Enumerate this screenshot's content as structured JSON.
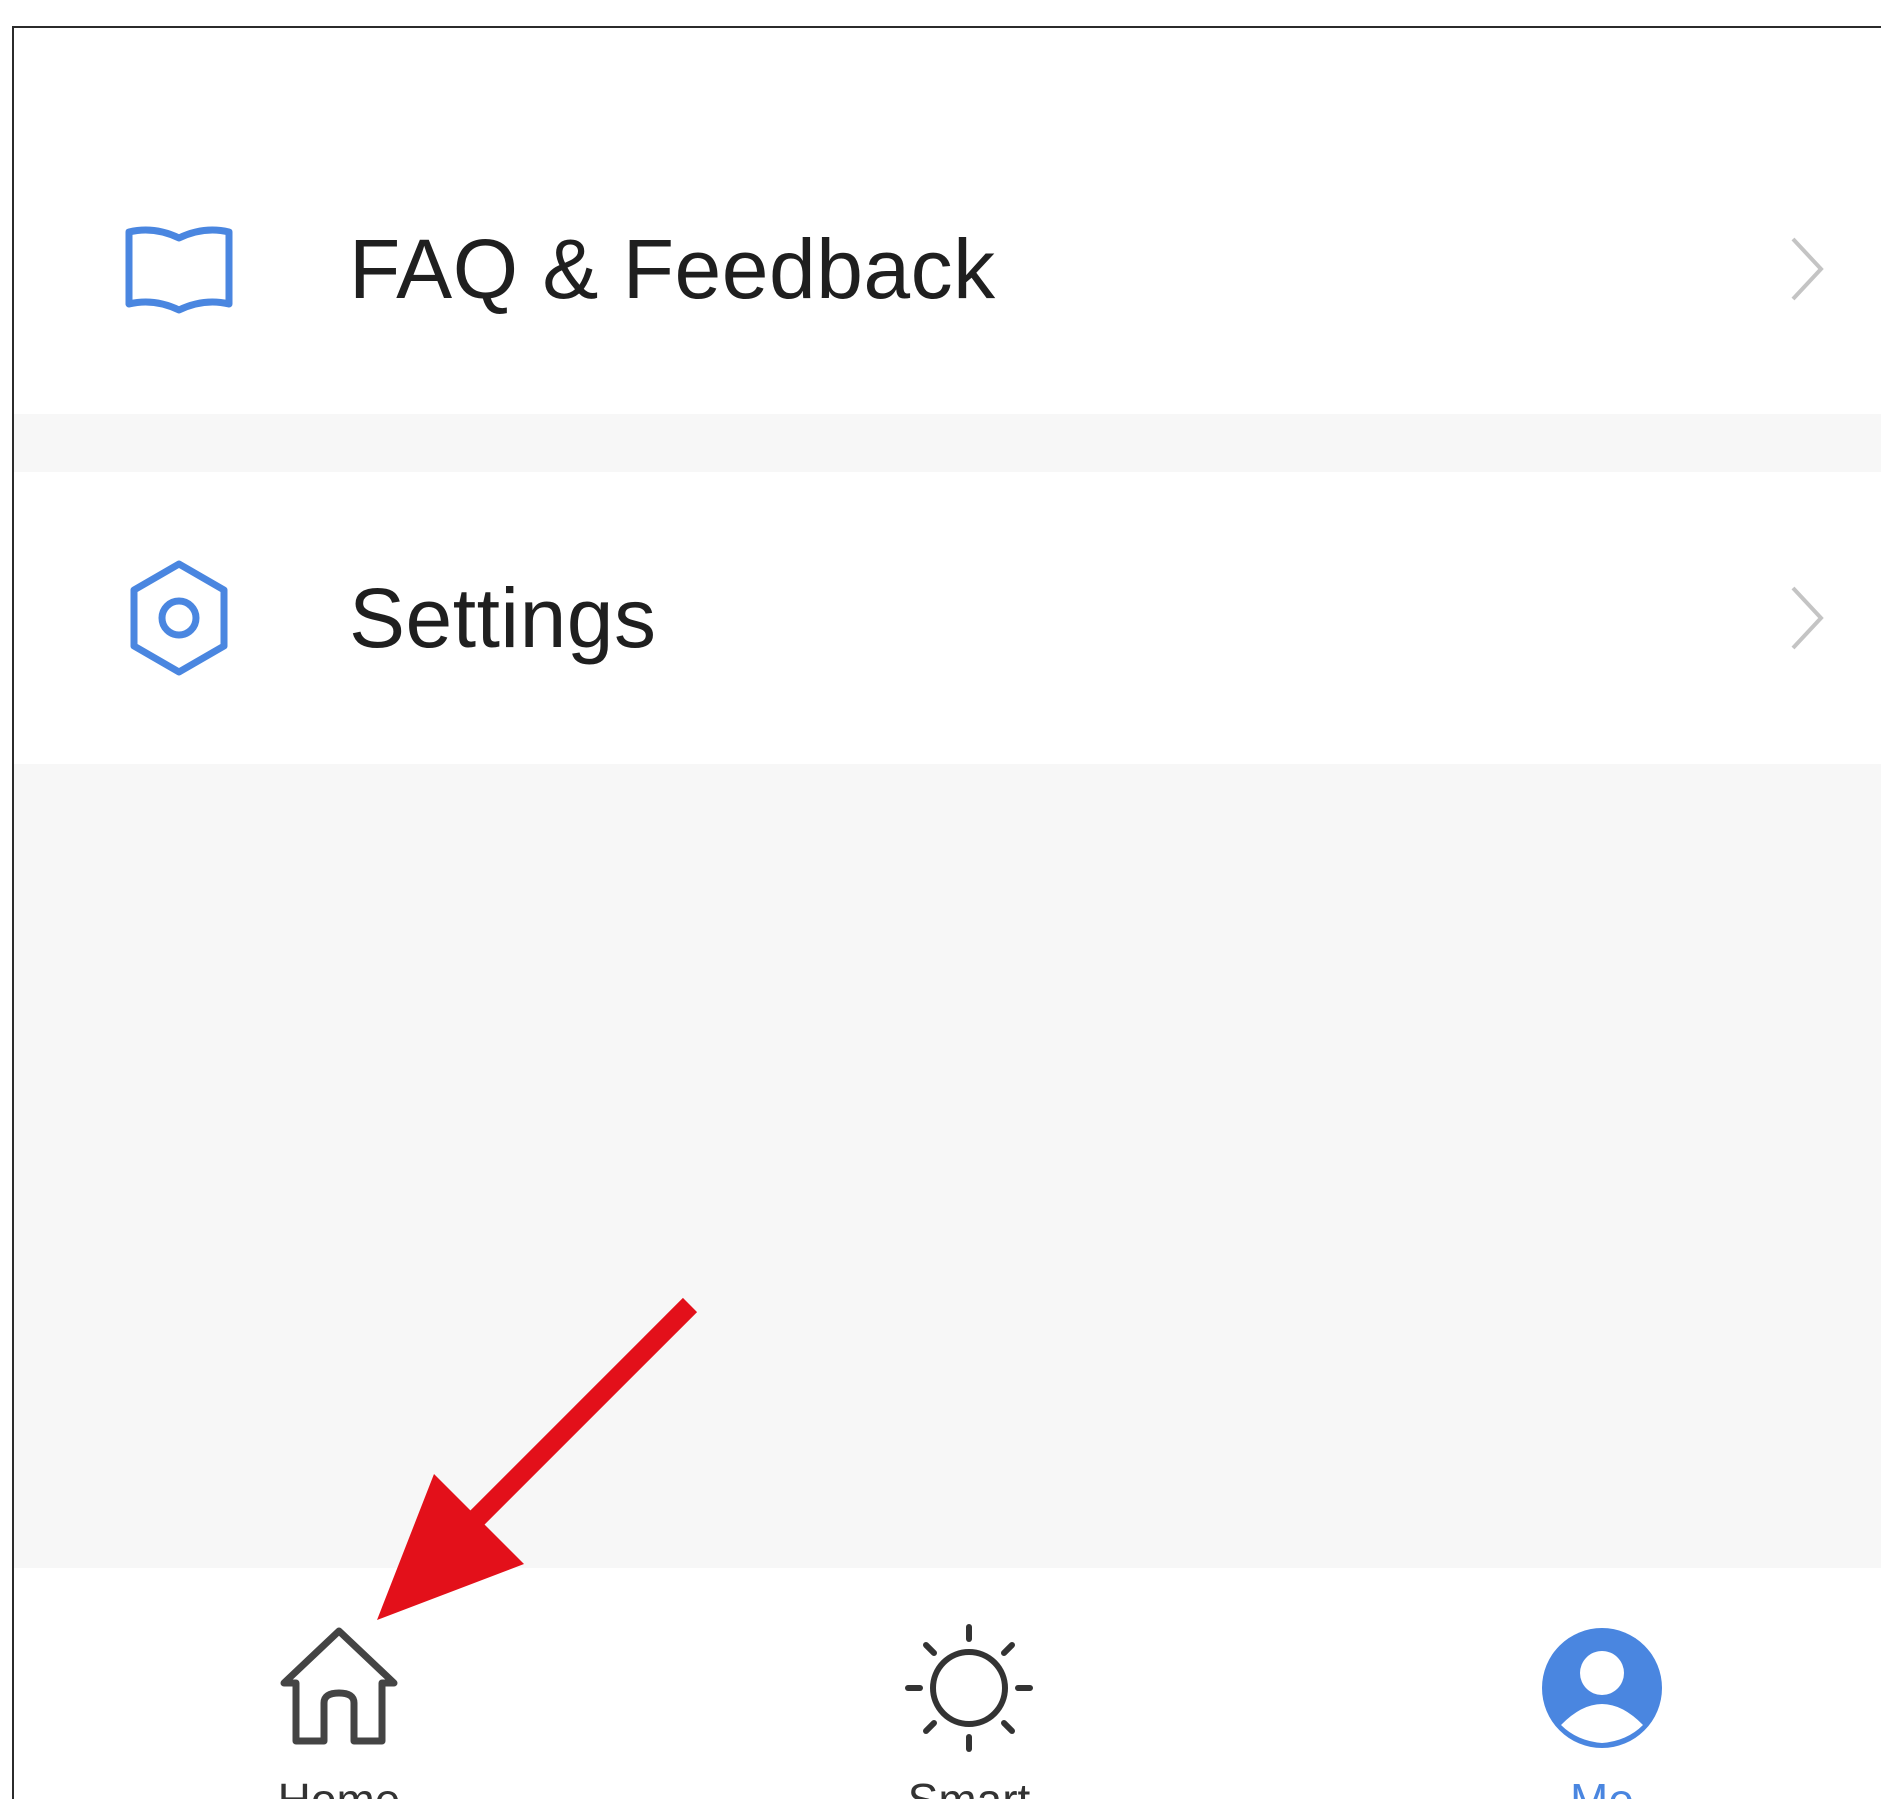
{
  "menu": {
    "items": [
      {
        "label": "FAQ & Feedback",
        "icon": "book-icon"
      },
      {
        "label": "Settings",
        "icon": "hexagon-settings-icon"
      }
    ]
  },
  "tabbar": {
    "tabs": [
      {
        "label": "Home",
        "icon": "house-icon",
        "active": false
      },
      {
        "label": "Smart",
        "icon": "sun-icon",
        "active": false
      },
      {
        "label": "Me",
        "icon": "user-icon",
        "active": true
      }
    ]
  },
  "colors": {
    "accent": "#4a86e0",
    "annotation": "#e3101a",
    "text": "#1f1f1f",
    "background": "#f7f7f7"
  }
}
